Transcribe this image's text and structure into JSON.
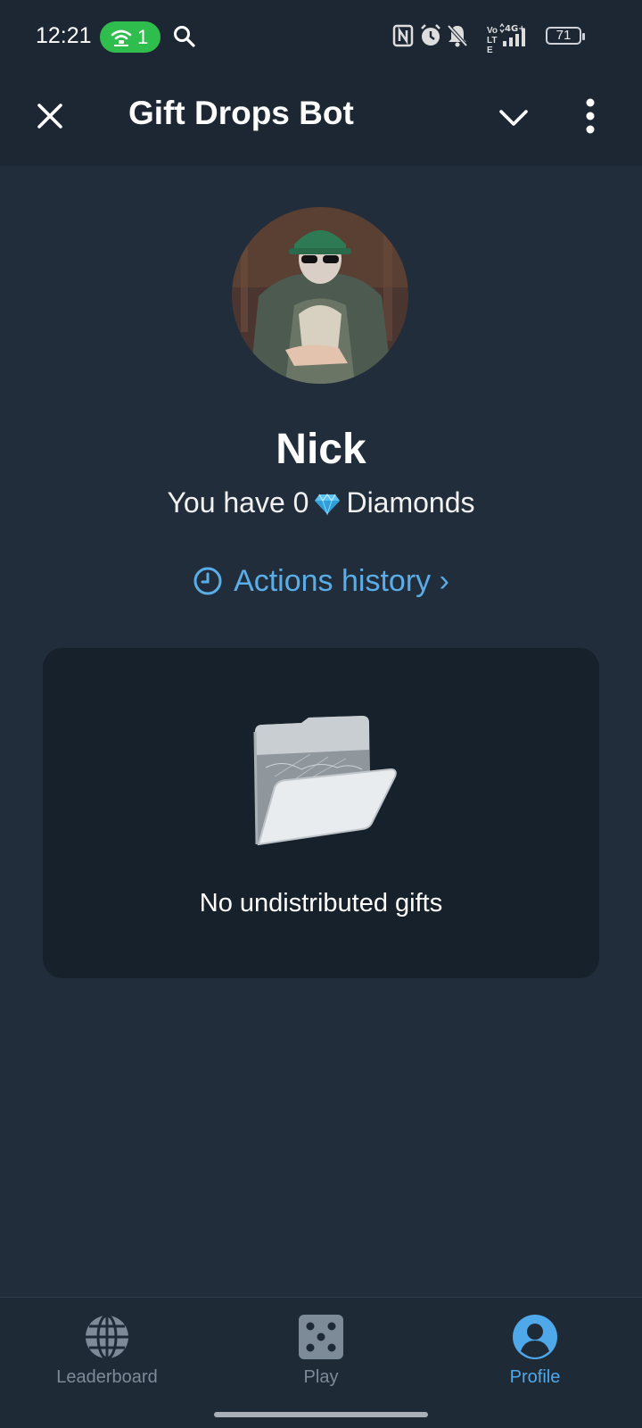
{
  "status_bar": {
    "time": "12:21",
    "hotspot_count": "1",
    "network": "4G+",
    "volte": "Vo LTE",
    "battery": "71"
  },
  "header": {
    "title": "Gift Drops Bot"
  },
  "profile": {
    "name": "Nick",
    "balance_prefix": "You have 0",
    "balance_suffix": "Diamonds",
    "actions_history": "Actions history ›"
  },
  "gifts": {
    "empty_text": "No undistributed gifts"
  },
  "bottom_nav": {
    "items": [
      {
        "label": "Leaderboard",
        "icon": "globe-icon",
        "active": false
      },
      {
        "label": "Play",
        "icon": "dice-icon",
        "active": false
      },
      {
        "label": "Profile",
        "icon": "profile-icon",
        "active": true
      }
    ]
  },
  "colors": {
    "background": "#212d3b",
    "header": "#1c2733",
    "card": "#17212b",
    "accent": "#5aaee8",
    "hotspot": "#2fbd4d"
  }
}
